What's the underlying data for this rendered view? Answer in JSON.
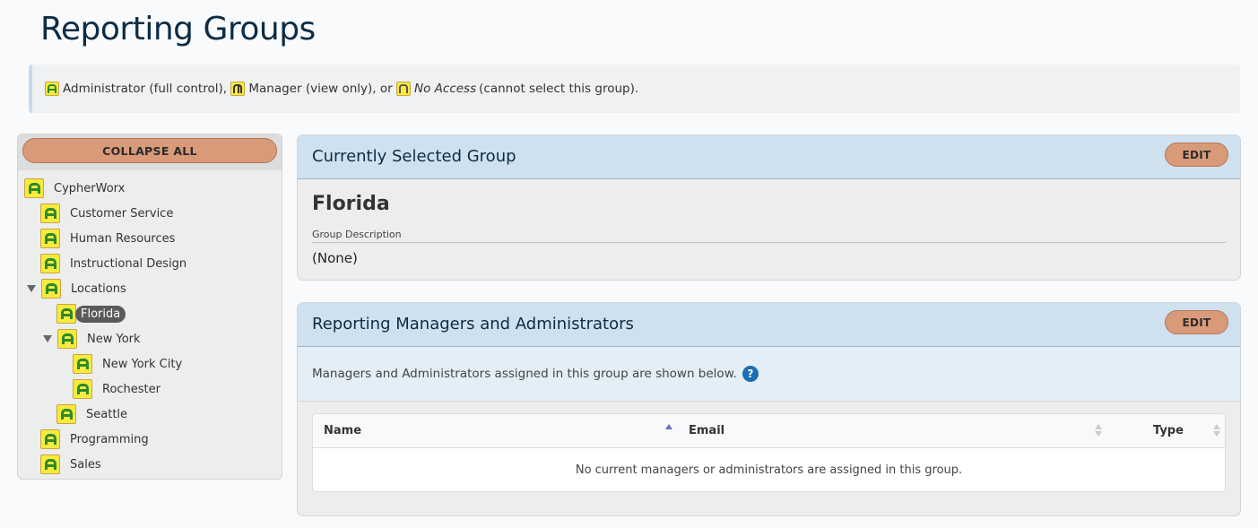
{
  "page": {
    "title": "Reporting Groups"
  },
  "legend": {
    "admin_label": "Administrator",
    "admin_desc": "(full control),",
    "manager_label": "Manager",
    "manager_desc": "(view only), or",
    "noaccess_label": "No Access",
    "noaccess_desc": "(cannot select this group)."
  },
  "tree": {
    "collapse_label": "COLLAPSE ALL",
    "items": [
      {
        "label": "CypherWorx"
      },
      {
        "label": "Customer Service"
      },
      {
        "label": "Human Resources"
      },
      {
        "label": "Instructional Design"
      },
      {
        "label": "Locations"
      },
      {
        "label": "Florida"
      },
      {
        "label": "New York"
      },
      {
        "label": "New York City"
      },
      {
        "label": "Rochester"
      },
      {
        "label": "Seattle"
      },
      {
        "label": "Programming"
      },
      {
        "label": "Sales"
      }
    ]
  },
  "selected": {
    "header": "Currently Selected Group",
    "edit_label": "EDIT",
    "name": "Florida",
    "desc_label": "Group Description",
    "desc_value": "(None)"
  },
  "managers": {
    "header": "Reporting Managers and Administrators",
    "edit_label": "EDIT",
    "info": "Managers and Administrators assigned in this group are shown below.",
    "help_glyph": "?",
    "columns": [
      "Name",
      "Email",
      "Type"
    ],
    "empty": "No current managers or administrators are assigned in this group."
  },
  "colors": {
    "accent_button": "#d89a78",
    "header_bg": "#cfe1ee",
    "title": "#0d2c45"
  }
}
